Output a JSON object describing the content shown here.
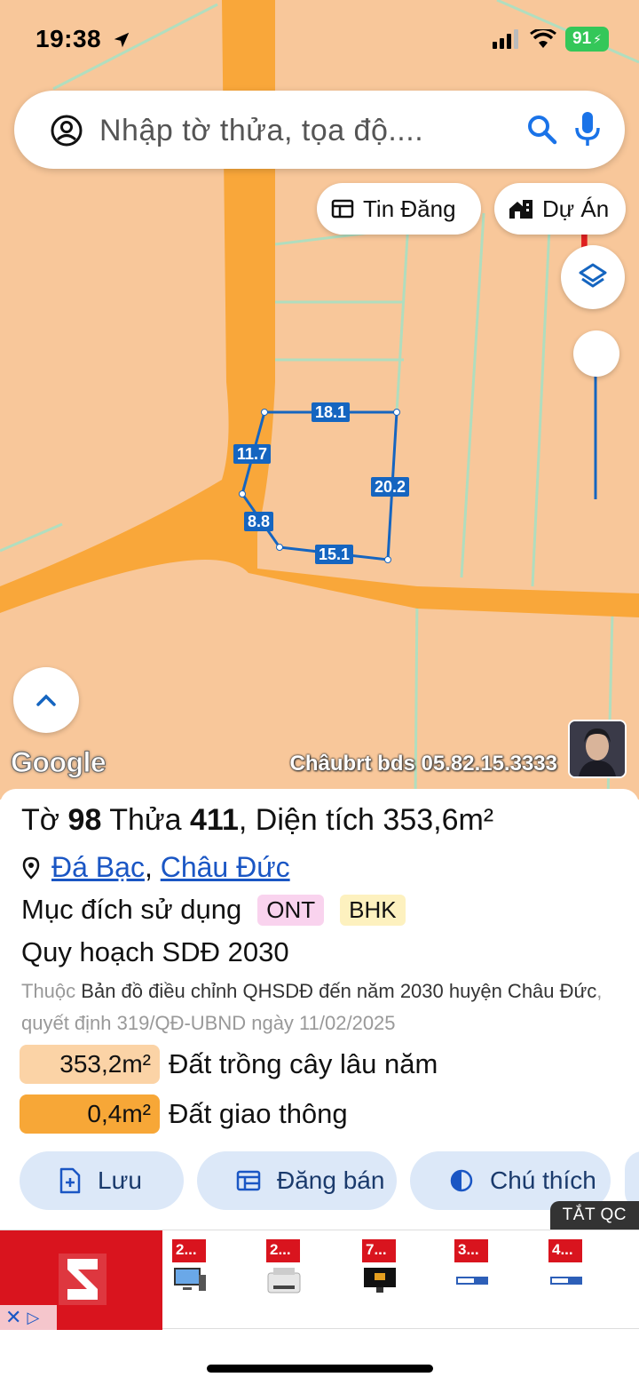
{
  "status": {
    "time": "19:38",
    "battery": "91"
  },
  "search": {
    "placeholder": "Nhập tờ thửa, tọa độ...."
  },
  "chips": {
    "listings": "Tin Đăng",
    "projects": "Dự Án"
  },
  "parcel_edges": {
    "top": "18.1",
    "upper_left": "11.7",
    "right": "20.2",
    "lower_left": "8.8",
    "bottom": "15.1"
  },
  "map": {
    "google": "Google",
    "watermark": "Châubrt bds 05.82.15.3333"
  },
  "parcel": {
    "sheet_label": "Tờ",
    "sheet_no": "98",
    "lot_label": "Thửa",
    "lot_no": "411",
    "area_label": ", Diện tích",
    "area_value": "353,6m²",
    "commune": "Đá Bạc",
    "district": "Châu Đức",
    "purpose_label": "Mục đích sử dụng",
    "purpose_tags": [
      "ONT",
      "BHK"
    ],
    "plan_title": "Quy hoạch SDĐ 2030",
    "desc_prefix": "Thuộc",
    "desc_map": "Bản đồ điều chỉnh QHSDĐ đến năm 2030 huyện Châu Đức",
    "desc_decision": ", quyết định 319/QĐ-UBND ngày 11/02/2025",
    "areas": [
      {
        "value": "353,2m²",
        "label": "Đất trồng cây lâu năm",
        "color": "#fbd3a6"
      },
      {
        "value": "0,4m²",
        "label": "Đất giao thông",
        "color": "#f7a737"
      }
    ]
  },
  "actions": {
    "save": "Lưu",
    "post": "Đăng bán",
    "legend": "Chú thích"
  },
  "ads": {
    "close_label": "TẮT QC",
    "prices": [
      "2...",
      "2...",
      "7...",
      "3...",
      "4..."
    ]
  },
  "colors": {
    "map_land": "#f8c79a",
    "road": "#f9a73a",
    "accent": "#1565c0",
    "chip_bg": "#dce8f8"
  }
}
